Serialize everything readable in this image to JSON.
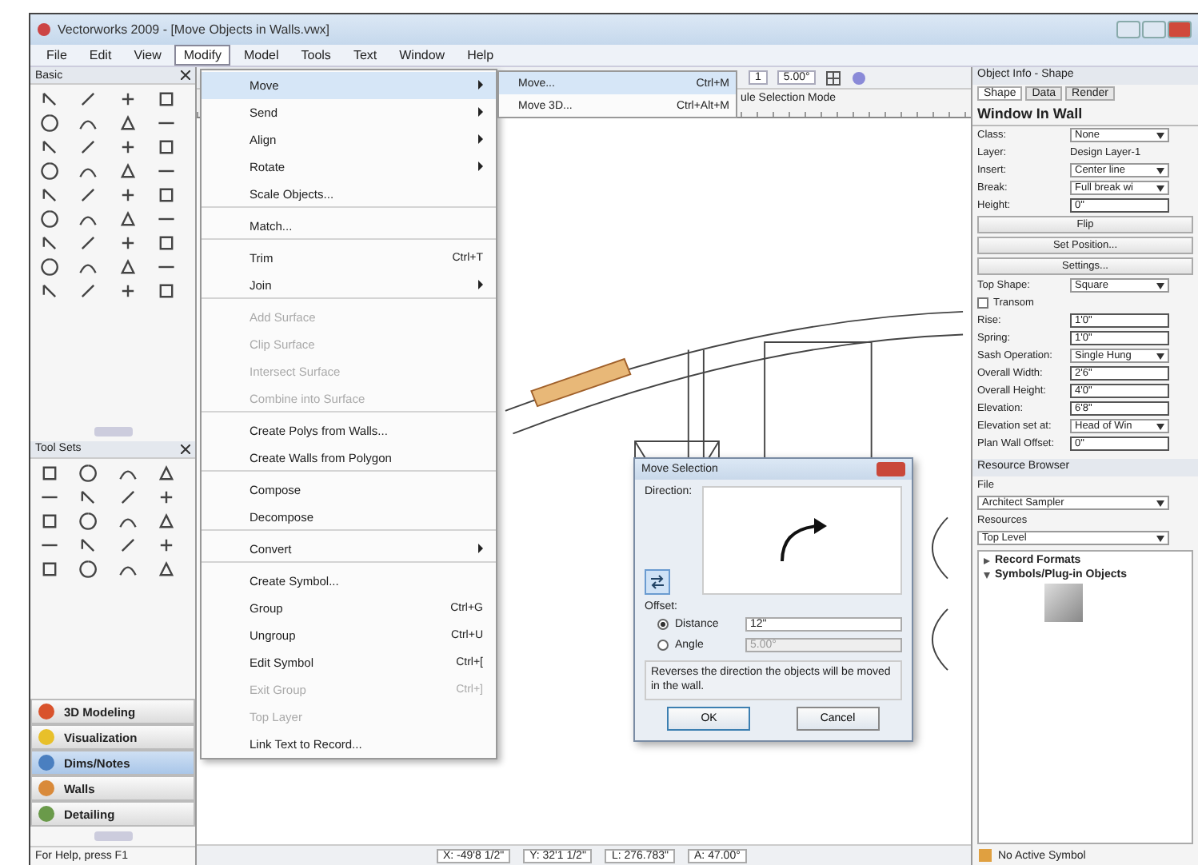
{
  "window": {
    "title": "Vectorworks 2009 - [Move Objects in Walls.vwx]"
  },
  "menubar": [
    {
      "label": "File",
      "selected": false
    },
    {
      "label": "Edit",
      "selected": false
    },
    {
      "label": "View",
      "selected": false
    },
    {
      "label": "Modify",
      "selected": true
    },
    {
      "label": "Model",
      "selected": false
    },
    {
      "label": "Tools",
      "selected": false
    },
    {
      "label": "Text",
      "selected": false
    },
    {
      "label": "Window",
      "selected": false
    },
    {
      "label": "Help",
      "selected": false
    }
  ],
  "basic_palette": {
    "title": "Basic"
  },
  "tool_sets_palette": {
    "title": "Tool Sets"
  },
  "workspaces": [
    {
      "label": "3D Modeling",
      "selected": false,
      "color": "#d9532c"
    },
    {
      "label": "Visualization",
      "selected": false,
      "color": "#e8c02a"
    },
    {
      "label": "Dims/Notes",
      "selected": true,
      "color": "#4a7fc0"
    },
    {
      "label": "Walls",
      "selected": false,
      "color": "#d98a3a"
    },
    {
      "label": "Detailing",
      "selected": false,
      "color": "#6a9a4a"
    }
  ],
  "status": "For Help, press F1",
  "modify_menu": [
    {
      "label": "Move",
      "submenu": true,
      "disabled": false,
      "selected": true,
      "separator_after": false
    },
    {
      "label": "Send",
      "submenu": true,
      "disabled": false,
      "selected": false,
      "separator_after": false
    },
    {
      "label": "Align",
      "submenu": true,
      "disabled": false,
      "selected": false,
      "separator_after": false
    },
    {
      "label": "Rotate",
      "submenu": true,
      "disabled": false,
      "selected": false,
      "separator_after": false
    },
    {
      "label": "Scale Objects...",
      "submenu": false,
      "disabled": false,
      "selected": false,
      "separator_after": true
    },
    {
      "label": "Match...",
      "submenu": false,
      "disabled": false,
      "selected": false,
      "separator_after": true
    },
    {
      "label": "Trim",
      "shortcut": "Ctrl+T",
      "submenu": false,
      "disabled": false,
      "selected": false,
      "separator_after": false
    },
    {
      "label": "Join",
      "submenu": true,
      "disabled": false,
      "selected": false,
      "separator_after": true
    },
    {
      "label": "Add Surface",
      "submenu": false,
      "disabled": true,
      "selected": false,
      "separator_after": false
    },
    {
      "label": "Clip Surface",
      "submenu": false,
      "disabled": true,
      "selected": false,
      "separator_after": false
    },
    {
      "label": "Intersect Surface",
      "submenu": false,
      "disabled": true,
      "selected": false,
      "separator_after": false
    },
    {
      "label": "Combine into Surface",
      "submenu": false,
      "disabled": true,
      "selected": false,
      "separator_after": true
    },
    {
      "label": "Create Polys from Walls...",
      "submenu": false,
      "disabled": false,
      "selected": false,
      "separator_after": false
    },
    {
      "label": "Create Walls from Polygon",
      "submenu": false,
      "disabled": false,
      "selected": false,
      "separator_after": true
    },
    {
      "label": "Compose",
      "submenu": false,
      "disabled": false,
      "selected": false,
      "separator_after": false
    },
    {
      "label": "Decompose",
      "submenu": false,
      "disabled": false,
      "selected": false,
      "separator_after": true
    },
    {
      "label": "Convert",
      "submenu": true,
      "disabled": false,
      "selected": false,
      "separator_after": true
    },
    {
      "label": "Create Symbol...",
      "submenu": false,
      "disabled": false,
      "selected": false,
      "separator_after": false
    },
    {
      "label": "Group",
      "shortcut": "Ctrl+G",
      "submenu": false,
      "disabled": false,
      "selected": false,
      "separator_after": false
    },
    {
      "label": "Ungroup",
      "shortcut": "Ctrl+U",
      "submenu": false,
      "disabled": false,
      "selected": false,
      "separator_after": false
    },
    {
      "label": "Edit Symbol",
      "shortcut": "Ctrl+[",
      "submenu": false,
      "disabled": false,
      "selected": false,
      "separator_after": false
    },
    {
      "label": "Exit Group",
      "shortcut": "Ctrl+]",
      "submenu": false,
      "disabled": true,
      "selected": false,
      "separator_after": false
    },
    {
      "label": "Top Layer",
      "submenu": false,
      "disabled": true,
      "selected": false,
      "separator_after": false
    },
    {
      "label": "Link Text to Record...",
      "submenu": false,
      "disabled": false,
      "selected": false,
      "separator_after": false
    }
  ],
  "move_submenu": [
    {
      "label": "Move...",
      "shortcut": "Ctrl+M",
      "selected": true
    },
    {
      "label": "Move 3D...",
      "shortcut": "Ctrl+Alt+M",
      "selected": false
    }
  ],
  "toolbar": {
    "layer_number": "1",
    "angle": "5.00°",
    "mode_label": "ule Selection Mode"
  },
  "object_info": {
    "title": "Object Info - Shape",
    "tabs": [
      {
        "label": "Shape",
        "selected": true
      },
      {
        "label": "Data",
        "selected": false
      },
      {
        "label": "Render",
        "selected": false
      }
    ],
    "heading": "Window In Wall",
    "fields": [
      {
        "kind": "select",
        "label": "Class:",
        "value": "None"
      },
      {
        "kind": "text",
        "label": "Layer:",
        "value": "Design Layer-1"
      },
      {
        "kind": "select",
        "label": "Insert:",
        "value": "Center line"
      },
      {
        "kind": "select",
        "label": "Break:",
        "value": "Full break wi"
      },
      {
        "kind": "input",
        "label": "Height:",
        "value": "0\""
      },
      {
        "kind": "button",
        "label": "Flip"
      },
      {
        "kind": "button",
        "label": "Set Position..."
      },
      {
        "kind": "button",
        "label": "Settings..."
      },
      {
        "kind": "select",
        "label": "Top Shape:",
        "value": "Square"
      },
      {
        "kind": "checkbox",
        "label": "Transom",
        "checked": false
      },
      {
        "kind": "input",
        "label": "Rise:",
        "value": "1'0\""
      },
      {
        "kind": "input",
        "label": "Spring:",
        "value": "1'0\""
      },
      {
        "kind": "select",
        "label": "Sash Operation:",
        "value": "Single Hung"
      },
      {
        "kind": "input",
        "label": "Overall Width:",
        "value": "2'6\""
      },
      {
        "kind": "input",
        "label": "Overall Height:",
        "value": "4'0\""
      },
      {
        "kind": "input",
        "label": "Elevation:",
        "value": "6'8\""
      },
      {
        "kind": "select",
        "label": "Elevation set at:",
        "value": "Head of Win"
      },
      {
        "kind": "input",
        "label": "Plan Wall Offset:",
        "value": "0\""
      }
    ]
  },
  "resource_browser": {
    "title": "Resource Browser",
    "file_label": "File",
    "file": "Architect Sampler",
    "resources_label": "Resources",
    "folder": "Top Level",
    "tree": [
      {
        "label": "Record Formats",
        "expanded": false
      },
      {
        "label": "Symbols/Plug-in Objects",
        "expanded": true
      }
    ],
    "active_symbol": "No Active Symbol"
  },
  "dialog": {
    "title": "Move Selection",
    "direction_label": "Direction:",
    "offset_label": "Offset:",
    "options": [
      {
        "label": "Distance",
        "value": "12\"",
        "selected": true,
        "disabled": false
      },
      {
        "label": "Angle",
        "value": "5.00°",
        "selected": false,
        "disabled": true
      }
    ],
    "help": "Reverses the direction the objects will be moved in the wall.",
    "buttons": [
      {
        "label": "OK",
        "default": true
      },
      {
        "label": "Cancel",
        "default": false
      }
    ]
  },
  "coordinates": [
    "X: -49'8 1/2\"",
    "Y: 32'1 1/2\"",
    "L: 276.783\"",
    "A: 47.00°"
  ]
}
